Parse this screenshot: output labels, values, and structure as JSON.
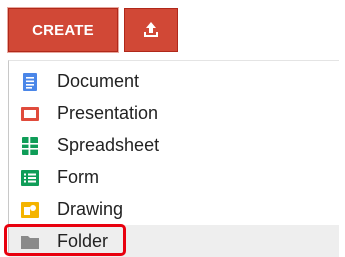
{
  "toolbar": {
    "create_label": "CREATE"
  },
  "menu": {
    "items": [
      {
        "label": "Document",
        "icon": "document-icon",
        "color": "#4a86e8"
      },
      {
        "label": "Presentation",
        "icon": "presentation-icon",
        "color": "#e04b3c"
      },
      {
        "label": "Spreadsheet",
        "icon": "spreadsheet-icon",
        "color": "#0f9d58"
      },
      {
        "label": "Form",
        "icon": "form-icon",
        "color": "#0f9d58"
      },
      {
        "label": "Drawing",
        "icon": "drawing-icon",
        "color": "#f4b400"
      },
      {
        "label": "Folder",
        "icon": "folder-icon",
        "color": "#8a8a8a"
      }
    ]
  },
  "colors": {
    "accent": "#d14836",
    "highlight": "#e8000e"
  }
}
